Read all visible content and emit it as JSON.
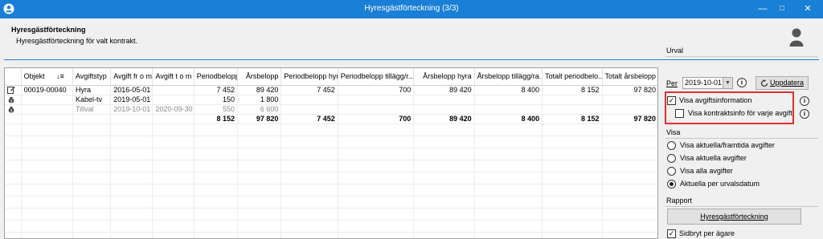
{
  "window": {
    "title": "Hyresgästförteckning (3/3)",
    "controls": {
      "minimize": "—",
      "maximize": "□",
      "close": "✕"
    }
  },
  "header": {
    "title": "Hyresgästförteckning",
    "subtitle": "Hyresgästförteckning för valt kontrakt."
  },
  "table": {
    "columns": [
      "Objekt",
      "Avgiftstyp",
      "Avgift fr o m",
      "Avgift t o m",
      "Periodbelopp",
      "Årsbelopp",
      "Periodbelopp hyra",
      "Periodbelopp tillägg/r...",
      "Årsbelopp hyra",
      "Årsbelopp tillägg/ra...",
      "Totalt periodbelo...",
      "Totalt årsbelopp"
    ],
    "sort_icon": "↓≡",
    "rows": [
      {
        "icon": "edit-icon",
        "objekt": "00019-00040",
        "avgiftstyp": "Hyra",
        "from": "2016-05-01",
        "tom": "",
        "periodbelopp": "7 452",
        "arsbelopp": "89 420",
        "pb_hyra": "7 452",
        "pb_tillagg": "700",
        "ab_hyra": "89 420",
        "ab_tillagg": "8 400",
        "tot_period": "8 152",
        "tot_ars": "97 820"
      },
      {
        "icon": "money-bag-icon",
        "objekt": "",
        "avgiftstyp": "Kabel-tv",
        "from": "2019-05-01",
        "tom": "",
        "periodbelopp": "150",
        "arsbelopp": "1 800",
        "pb_hyra": "",
        "pb_tillagg": "",
        "ab_hyra": "",
        "ab_tillagg": "",
        "tot_period": "",
        "tot_ars": ""
      },
      {
        "icon": "money-bag-icon",
        "objekt": "",
        "avgiftstyp": "Tillval",
        "from": "2019-10-01",
        "tom": "2020-09-30",
        "periodbelopp": "550",
        "arsbelopp": "6 600",
        "pb_hyra": "",
        "pb_tillagg": "",
        "ab_hyra": "",
        "ab_tillagg": "",
        "tot_period": "",
        "tot_ars": ""
      }
    ],
    "totals": {
      "periodbelopp": "8 152",
      "arsbelopp": "97 820",
      "pb_hyra": "7 452",
      "pb_tillagg": "700",
      "ab_hyra": "89 420",
      "ab_tillagg": "8 400",
      "tot_period": "8 152",
      "tot_ars": "97 820"
    }
  },
  "panel": {
    "urval": {
      "label": "Urval",
      "per_label": "Per",
      "date_value": "2019-10-01",
      "update_button": "Uppdatera",
      "show_fee_info": {
        "label": "Visa avgiftsinformation",
        "checked": true
      },
      "show_contract_info": {
        "label": "Visa kontraktsinfo för varje avgift",
        "checked": false
      }
    },
    "visa": {
      "label": "Visa",
      "options": [
        {
          "label": "Visa aktuella/framtida avgifter",
          "selected": false
        },
        {
          "label": "Visa aktuella avgifter",
          "selected": false
        },
        {
          "label": "Visa alla avgifter",
          "selected": false
        },
        {
          "label": "Aktuella per urvalsdatum",
          "selected": true
        }
      ]
    },
    "rapport": {
      "label": "Rapport",
      "report_button": "Hyresgästförteckning",
      "page_break": {
        "label": "Sidbryt per ägare",
        "checked": true
      }
    },
    "info_icon_glyph": "i",
    "check_glyph": "✓"
  },
  "colors": {
    "titlebar": "#1a7fd6",
    "highlight": "#e03030",
    "accent_line": "#1a7fd6"
  }
}
